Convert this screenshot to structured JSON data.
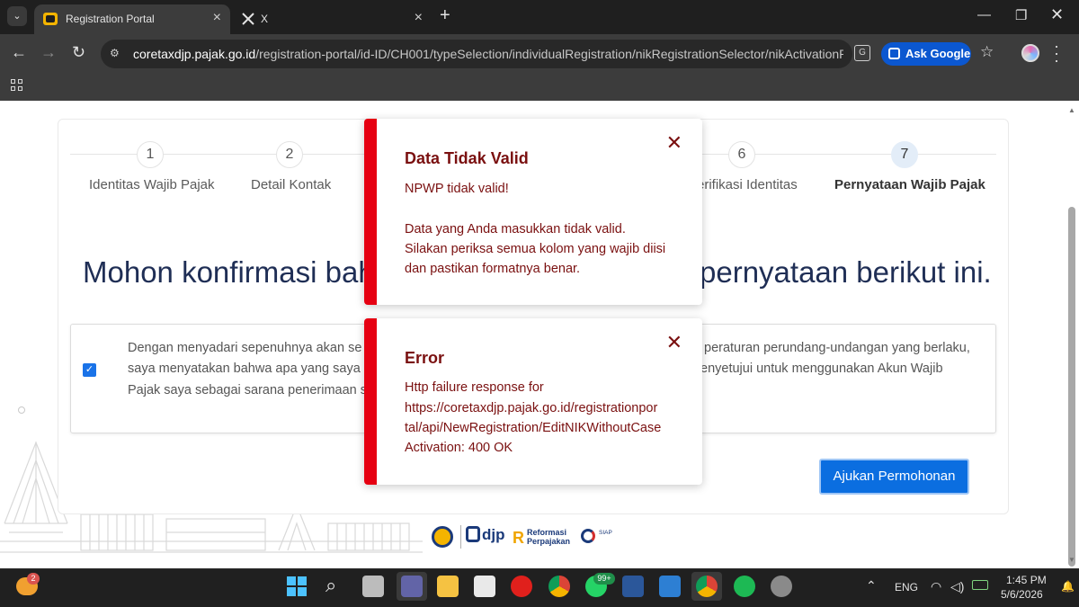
{
  "browser": {
    "tabs": [
      {
        "title": "Registration Portal",
        "active": true,
        "favicon": "portal-favicon-icon"
      },
      {
        "title": "X",
        "active": false,
        "favicon": "x-logo-icon"
      }
    ],
    "url_host": "coretaxdjp.pajak.go.id",
    "url_path": "/registration-portal/id-ID/CH001/typeSelection/individualRegistration/nikRegistrationSelector/nikActivationRegist...",
    "ask_google_label": "Ask Google"
  },
  "stepper": {
    "steps": [
      {
        "number": "1",
        "label": "Identitas Wajib Pajak"
      },
      {
        "number": "2",
        "label": "Detail Kontak"
      },
      {
        "number": "6",
        "label": "erifikasi Identitas"
      },
      {
        "number": "7",
        "label": "Pernyataan Wajib Pajak",
        "current": true
      }
    ]
  },
  "main": {
    "headline_left": "Mohon konfirmasi bah",
    "headline_right": "pernyataan berikut ini.",
    "confirm_left_lines": [
      "Dengan menyadari sepenuhnya akan se",
      "saya menyatakan bahwa apa yang saya",
      "Pajak saya sebagai sarana penerimaan s"
    ],
    "confirm_right_lines": [
      "peraturan perundang-undangan yang berlaku,",
      "enyetujui untuk menggunakan Akun Wajib"
    ],
    "checkbox_checked": true,
    "submit_label": "Ajukan Permohonan"
  },
  "footer_logos": {
    "djp": "djp",
    "reformasi_line1": "Reformasi",
    "reformasi_line2": "Perpajakan",
    "siap": "SIAP"
  },
  "toasts": [
    {
      "title": "Data Tidak Valid",
      "lines": [
        "NPWP tidak valid!",
        "",
        "Data yang Anda masukkan tidak valid.",
        "Silakan periksa semua kolom yang wajib diisi",
        "dan pastikan formatnya benar."
      ]
    },
    {
      "title": "Error",
      "lines": [
        "Http failure response for",
        "https://coretaxdjp.pajak.go.id/registrationpor",
        "tal/api/NewRegistration/EditNIKWithoutCase",
        "Activation: 400 OK"
      ]
    }
  ],
  "taskbar": {
    "weather_badge": "2",
    "whatsapp_badge": "99+",
    "language": "ENG",
    "time": "1:45 PM",
    "date": "5/6/2026"
  },
  "colors": {
    "toast_accent": "#e60012",
    "toast_text": "#7a1010",
    "primary_button": "#0b6ee0",
    "headline": "#1f2e55"
  }
}
